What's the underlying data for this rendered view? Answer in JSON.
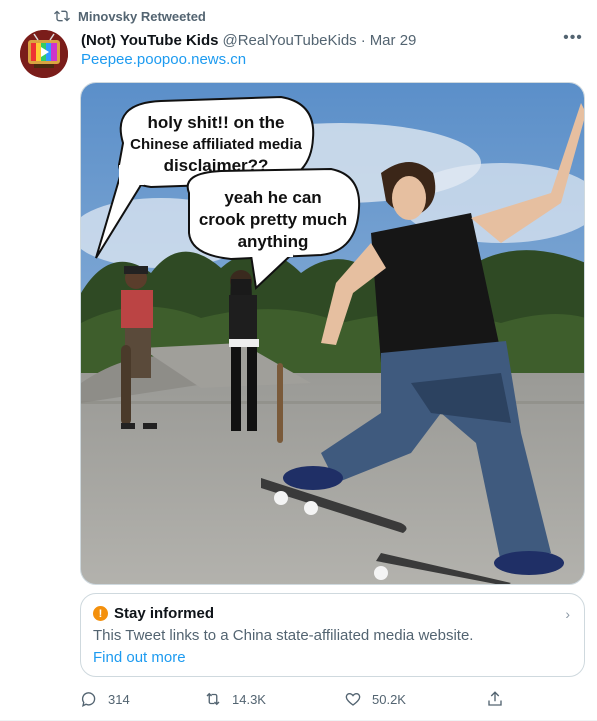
{
  "retweet": {
    "label": "Minovsky Retweeted"
  },
  "author": {
    "display_name": "(Not) YouTube Kids",
    "handle": "@RealYouTubeKids",
    "separator": "·",
    "date": "Mar 29"
  },
  "tweet": {
    "link_text": "Peepee.poopoo.news.cn"
  },
  "media": {
    "bubble1": [
      "holy shit!! on the",
      "Chinese affiliated media",
      "disclaimer??"
    ],
    "bubble2": [
      "yeah he can",
      "crook pretty much",
      "anything"
    ]
  },
  "notice": {
    "title": "Stay informed",
    "body": "This Tweet links to a China state-affiliated media website.",
    "link": "Find out more"
  },
  "actions": {
    "replies": "314",
    "retweets": "14.3K",
    "likes": "50.2K"
  },
  "colors": {
    "link": "#1d9bf0",
    "muted": "#536471",
    "warning": "#f4900c"
  }
}
